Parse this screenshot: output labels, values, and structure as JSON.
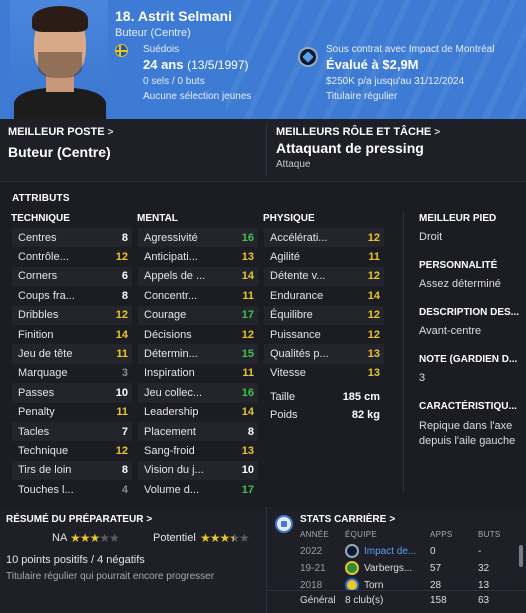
{
  "header": {
    "name": "18. Astrit Selmani",
    "position": "Buteur (Centre)",
    "nationality": "Suédois",
    "age": "24 ans",
    "birthdate": "(13/5/1997)",
    "caps": "0 sels / 0 buts",
    "youth_caps": "Aucune sélection jeunes",
    "contract": "Sous contrat avec Impact de Montréal",
    "value": "Évalué à $2,9M",
    "salary": "$250K p/a jusqu'au 31/12/2024",
    "status": "Titulaire régulier",
    "accent_color": "#3d7bd4"
  },
  "best_position": {
    "label": "MEILLEUR POSTE",
    "value": "Buteur (Centre)"
  },
  "best_role": {
    "label": "MEILLEURS RÔLE ET TÂCHE",
    "value": "Attaquant de pressing",
    "sub": "Attaque"
  },
  "attributes": {
    "title": "ATTRIBUTS",
    "technical": {
      "heading": "TECHNIQUE",
      "rows": [
        {
          "name": "Centres",
          "value": "8"
        },
        {
          "name": "Contrôle...",
          "value": "12"
        },
        {
          "name": "Corners",
          "value": "6"
        },
        {
          "name": "Coups fra...",
          "value": "8"
        },
        {
          "name": "Dribbles",
          "value": "12"
        },
        {
          "name": "Finition",
          "value": "14"
        },
        {
          "name": "Jeu de tête",
          "value": "11"
        },
        {
          "name": "Marquage",
          "value": "3"
        },
        {
          "name": "Passes",
          "value": "10"
        },
        {
          "name": "Penalty",
          "value": "11"
        },
        {
          "name": "Tacles",
          "value": "7"
        },
        {
          "name": "Technique",
          "value": "12"
        },
        {
          "name": "Tirs de loin",
          "value": "8"
        },
        {
          "name": "Touches l...",
          "value": "4"
        }
      ]
    },
    "mental": {
      "heading": "MENTAL",
      "rows": [
        {
          "name": "Agressivité",
          "value": "16"
        },
        {
          "name": "Anticipati...",
          "value": "13"
        },
        {
          "name": "Appels de ...",
          "value": "14"
        },
        {
          "name": "Concentr...",
          "value": "11"
        },
        {
          "name": "Courage",
          "value": "17"
        },
        {
          "name": "Décisions",
          "value": "12"
        },
        {
          "name": "Détermin...",
          "value": "15"
        },
        {
          "name": "Inspiration",
          "value": "11"
        },
        {
          "name": "Jeu collec...",
          "value": "16"
        },
        {
          "name": "Leadership",
          "value": "14"
        },
        {
          "name": "Placement",
          "value": "8"
        },
        {
          "name": "Sang-froid",
          "value": "13"
        },
        {
          "name": "Vision du j...",
          "value": "10"
        },
        {
          "name": "Volume d...",
          "value": "17"
        }
      ]
    },
    "physical": {
      "heading": "PHYSIQUE",
      "rows": [
        {
          "name": "Accélérati...",
          "value": "12"
        },
        {
          "name": "Agilité",
          "value": "11"
        },
        {
          "name": "Détente v...",
          "value": "12"
        },
        {
          "name": "Endurance",
          "value": "14"
        },
        {
          "name": "Équilibre",
          "value": "12"
        },
        {
          "name": "Puissance",
          "value": "12"
        },
        {
          "name": "Qualités p...",
          "value": "13"
        },
        {
          "name": "Vitesse",
          "value": "13"
        }
      ],
      "height_label": "Taille",
      "height": "185 cm",
      "weight_label": "Poids",
      "weight": "82 kg"
    },
    "side": {
      "foot_label": "MEILLEUR PIED",
      "foot": "Droit",
      "personality_label": "PERSONNALITÉ",
      "personality": "Assez déterminé",
      "description_label": "DESCRIPTION DES...",
      "description": "Avant-centre",
      "gk_label": "NOTE (GARDIEN D...",
      "gk": "3",
      "traits_label": "CARACTÉRISTIQU...",
      "traits": "Repique dans l'axe depuis l'aile gauche"
    }
  },
  "coach_report": {
    "title": "RÉSUMÉ DU PRÉPARATEUR",
    "current_label": "NA",
    "current_stars": 3,
    "potential_label": "Potentiel",
    "potential_stars": 3.5,
    "points": "10 points positifs / 4 négatifs",
    "summary": "Titulaire régulier qui pourrait encore progresser"
  },
  "career": {
    "title": "STATS CARRIÈRE",
    "headers": [
      "ANNÉE",
      "ÉQUIPE",
      "APPS",
      "BUTS"
    ],
    "rows": [
      {
        "year": "2022",
        "team": "Impact de...",
        "apps": "0",
        "goals": "-"
      },
      {
        "year": "19-21",
        "team": "Varbergs...",
        "apps": "57",
        "goals": "32"
      },
      {
        "year": "2018",
        "team": "Torn",
        "apps": "28",
        "goals": "13"
      }
    ],
    "total_label": "Général",
    "total_clubs": "8 club(s)",
    "total_apps": "158",
    "total_goals": "63"
  }
}
